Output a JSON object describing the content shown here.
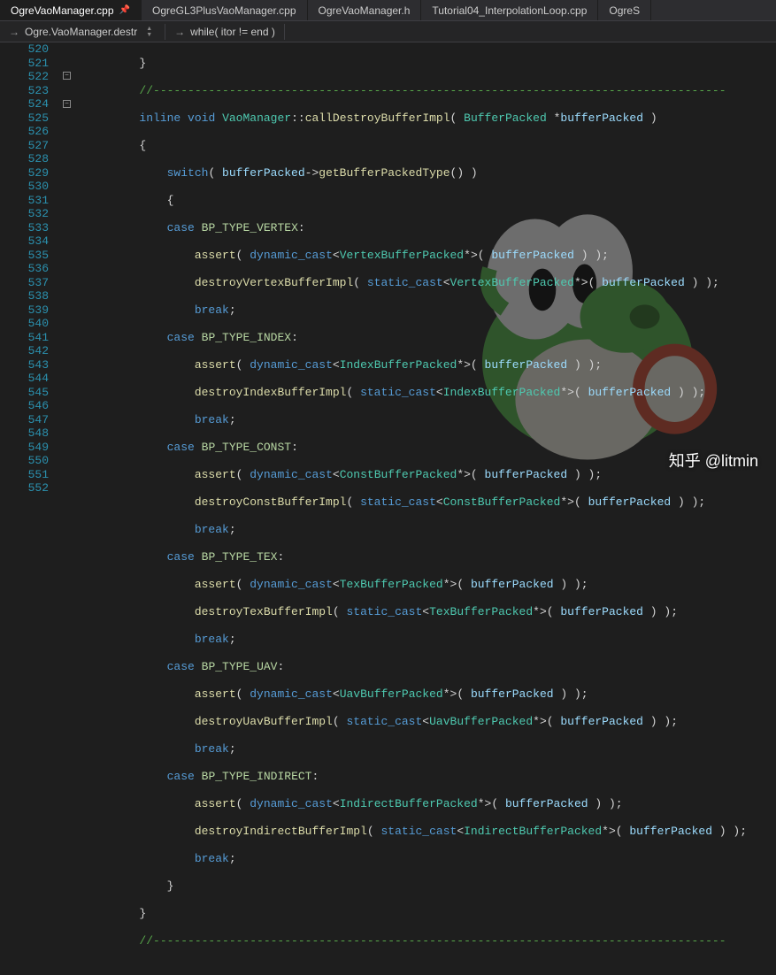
{
  "tabs": [
    {
      "label": "OgreVaoManager.cpp",
      "active": true,
      "pinned": true
    },
    {
      "label": "OgreGL3PlusVaoManager.cpp",
      "active": false
    },
    {
      "label": "OgreVaoManager.h",
      "active": false
    },
    {
      "label": "Tutorial04_InterpolationLoop.cpp",
      "active": false
    },
    {
      "label": "OgreS",
      "active": false
    }
  ],
  "nav": {
    "scope": "Ogre.VaoManager.destr",
    "context": "while( itor != end )"
  },
  "gutter": {
    "start": 520,
    "end": 552
  },
  "code": {
    "l520": "        }",
    "l521": "        //-----------------------------------------------------------------------------------",
    "l522_kw1": "inline",
    "l522_kw2": "void",
    "l522_cls": "VaoManager",
    "l522_fn": "callDestroyBufferImpl",
    "l522_t": "BufferPacked",
    "l522_p": "bufferPacked",
    "l523": "        {",
    "l524_kw": "switch",
    "l524_p": "bufferPacked",
    "l524_fn": "getBufferPackedType",
    "l525": "            {",
    "l526_kw": "case",
    "l526_e": "BP_TYPE_VERTEX",
    "l527_fn": "assert",
    "l527_kw": "dynamic_cast",
    "l527_t": "VertexBufferPacked",
    "l527_p": "bufferPacked",
    "l528_fn": "destroyVertexBufferImpl",
    "l528_kw": "static_cast",
    "l528_t": "VertexBufferPacked",
    "l528_p": "bufferPacked",
    "l529_kw": "break",
    "l530_kw": "case",
    "l530_e": "BP_TYPE_INDEX",
    "l531_fn": "assert",
    "l531_kw": "dynamic_cast",
    "l531_t": "IndexBufferPacked",
    "l531_p": "bufferPacked",
    "l532_fn": "destroyIndexBufferImpl",
    "l532_kw": "static_cast",
    "l532_t": "IndexBufferPacked",
    "l532_p": "bufferPacked",
    "l533_kw": "break",
    "l534_kw": "case",
    "l534_e": "BP_TYPE_CONST",
    "l535_fn": "assert",
    "l535_kw": "dynamic_cast",
    "l535_t": "ConstBufferPacked",
    "l535_p": "bufferPacked",
    "l536_fn": "destroyConstBufferImpl",
    "l536_kw": "static_cast",
    "l536_t": "ConstBufferPacked",
    "l536_p": "bufferPacked",
    "l537_kw": "break",
    "l538_kw": "case",
    "l538_e": "BP_TYPE_TEX",
    "l539_fn": "assert",
    "l539_kw": "dynamic_cast",
    "l539_t": "TexBufferPacked",
    "l539_p": "bufferPacked",
    "l540_fn": "destroyTexBufferImpl",
    "l540_kw": "static_cast",
    "l540_t": "TexBufferPacked",
    "l540_p": "bufferPacked",
    "l541_kw": "break",
    "l542_kw": "case",
    "l542_e": "BP_TYPE_UAV",
    "l543_fn": "assert",
    "l543_kw": "dynamic_cast",
    "l543_t": "UavBufferPacked",
    "l543_p": "bufferPacked",
    "l544_fn": "destroyUavBufferImpl",
    "l544_kw": "static_cast",
    "l544_t": "UavBufferPacked",
    "l544_p": "bufferPacked",
    "l545_kw": "break",
    "l546_kw": "case",
    "l546_e": "BP_TYPE_INDIRECT",
    "l547_fn": "assert",
    "l547_kw": "dynamic_cast",
    "l547_t": "IndirectBufferPacked",
    "l547_p": "bufferPacked",
    "l548_fn": "destroyIndirectBufferImpl",
    "l548_kw": "static_cast",
    "l548_t": "IndirectBufferPacked",
    "l548_p": "bufferPacked",
    "l549_kw": "break",
    "l550": "            }",
    "l551": "        }",
    "l552": "        //-----------------------------------------------------------------------------------"
  },
  "watermark": "知乎 @litmin"
}
